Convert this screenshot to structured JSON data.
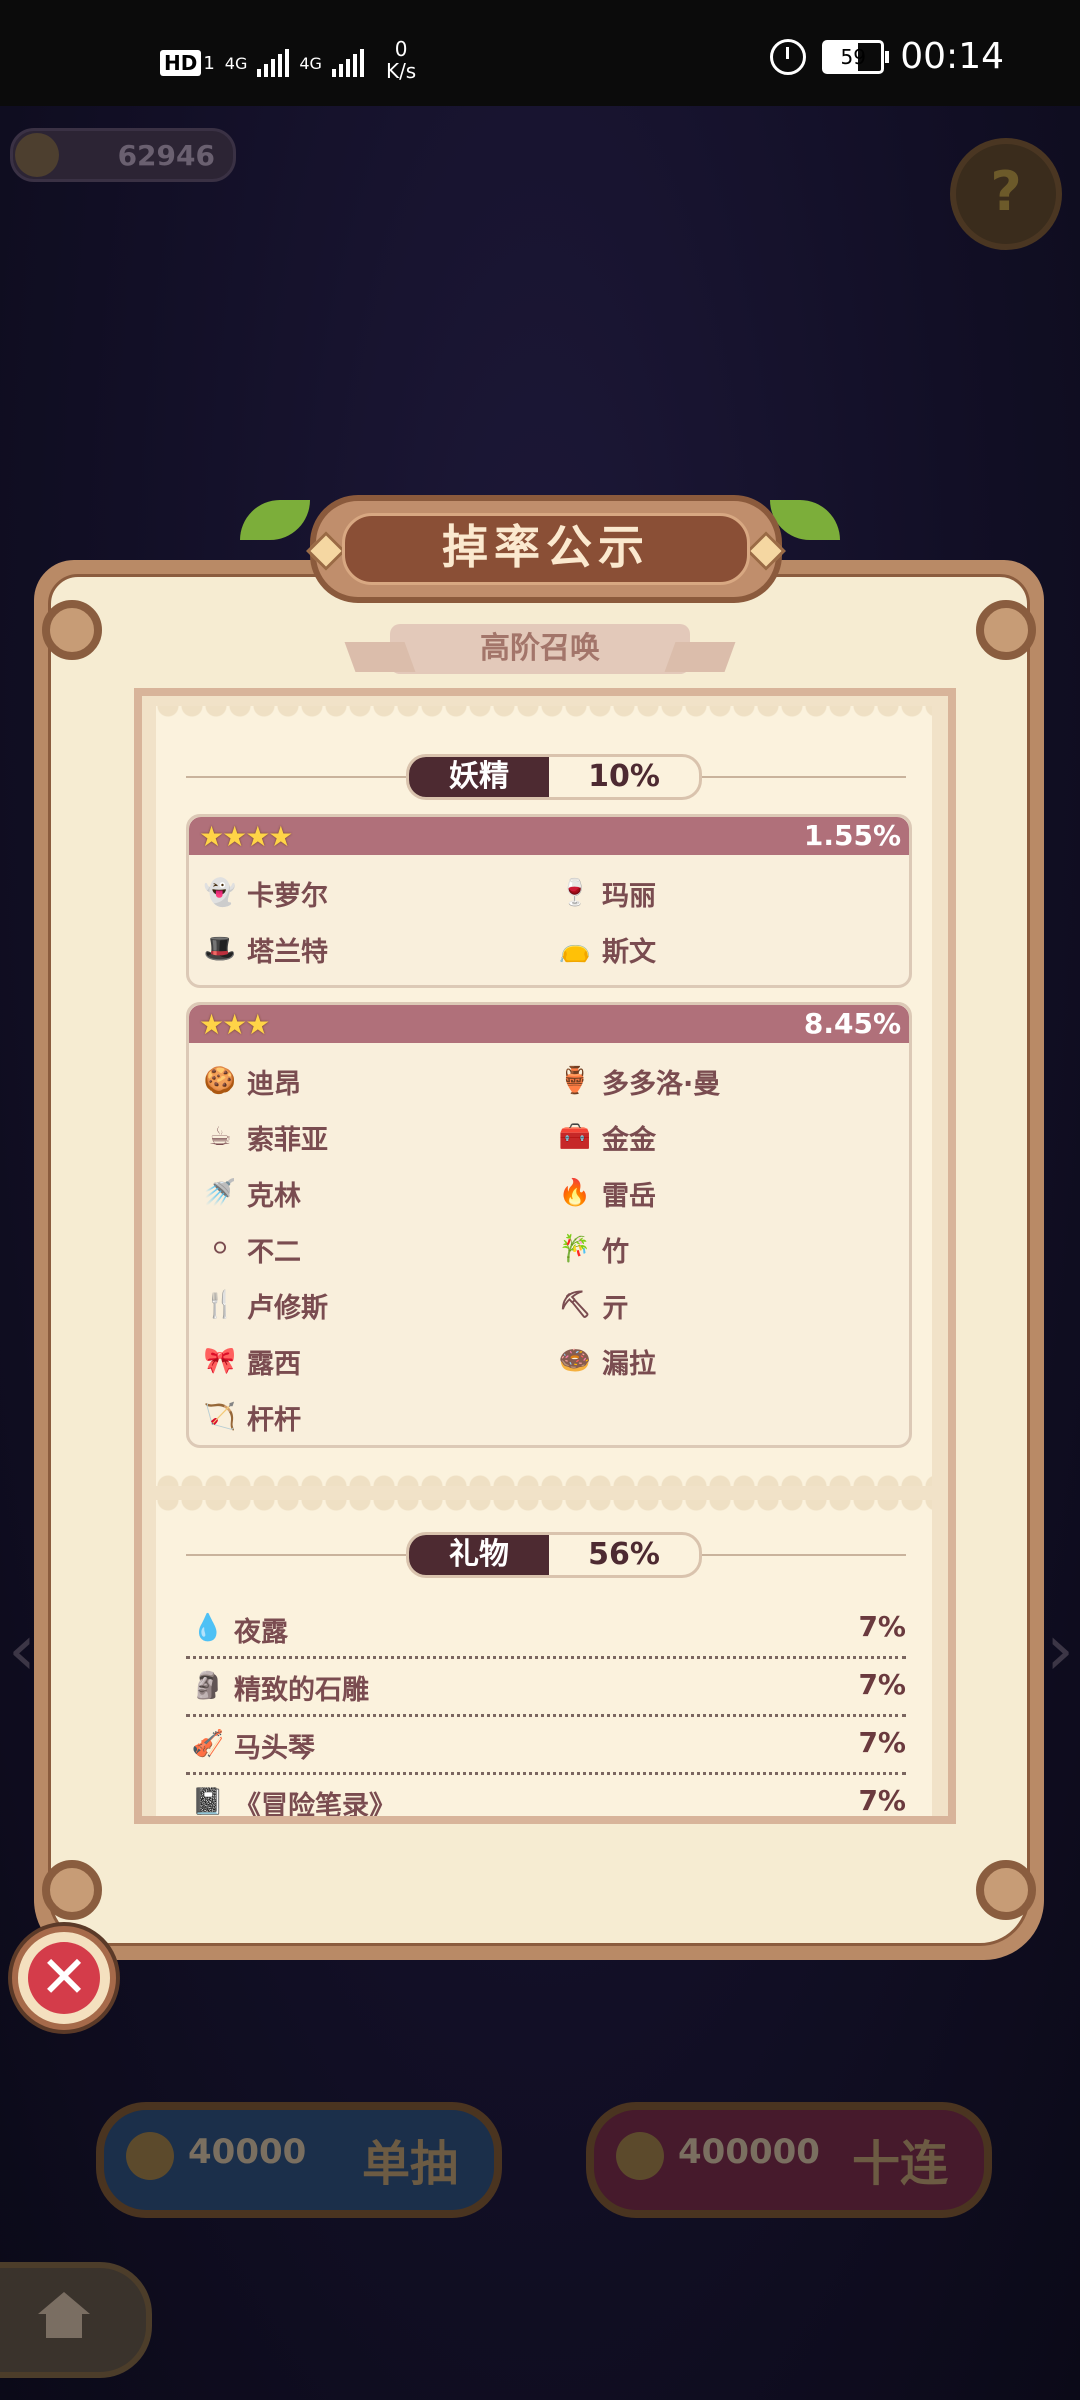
{
  "status_bar": {
    "hd": "HD",
    "sim": "1",
    "net1": "4G",
    "net2": "4G",
    "speed_value": "0",
    "speed_unit": "K/s",
    "battery": "59",
    "time": "00:14"
  },
  "hud": {
    "coins": "62946",
    "help_label": "?"
  },
  "panel": {
    "title": "掉率公示",
    "subtitle": "高阶召唤",
    "fairy_section": {
      "category": "妖精",
      "rate": "10%",
      "tiers": [
        {
          "stars": "★★★★",
          "rate": "1.55%",
          "items": [
            {
              "name": "卡萝尔",
              "icon": "ghost-icon",
              "glyph": "👻"
            },
            {
              "name": "玛丽",
              "icon": "potion-icon",
              "glyph": "🍷"
            },
            {
              "name": "塔兰特",
              "icon": "witch-hat-icon",
              "glyph": "🎩"
            },
            {
              "name": "斯文",
              "icon": "bag-icon",
              "glyph": "👝"
            }
          ]
        },
        {
          "stars": "★★★",
          "rate": "8.45%",
          "items": [
            {
              "name": "迪昂",
              "icon": "cookie-icon",
              "glyph": "🍪"
            },
            {
              "name": "多多洛·曼",
              "icon": "pot-icon",
              "glyph": "🏺"
            },
            {
              "name": "索菲亚",
              "icon": "teacup-icon",
              "glyph": "☕"
            },
            {
              "name": "金金",
              "icon": "chest-icon",
              "glyph": "🧰"
            },
            {
              "name": "克林",
              "icon": "watering-can-icon",
              "glyph": "🚿"
            },
            {
              "name": "雷岳",
              "icon": "torch-icon",
              "glyph": "🔥"
            },
            {
              "name": "不二",
              "icon": "snowball-icon",
              "glyph": "⚪"
            },
            {
              "name": "竹",
              "icon": "bamboo-icon",
              "glyph": "🎋"
            },
            {
              "name": "卢修斯",
              "icon": "fork-icon",
              "glyph": "🍴"
            },
            {
              "name": "亓",
              "icon": "shovel-icon",
              "glyph": "⛏"
            },
            {
              "name": "露西",
              "icon": "bow-icon",
              "glyph": "🎀"
            },
            {
              "name": "漏拉",
              "icon": "donut-icon",
              "glyph": "🍩"
            },
            {
              "name": "杆杆",
              "icon": "slingshot-icon",
              "glyph": "🏹"
            }
          ]
        }
      ]
    },
    "gift_section": {
      "category": "礼物",
      "rate": "56%",
      "items": [
        {
          "name": "夜露",
          "rate": "7%",
          "icon": "dew-icon",
          "glyph": "💧"
        },
        {
          "name": "精致的石雕",
          "rate": "7%",
          "icon": "statue-icon",
          "glyph": "🗿"
        },
        {
          "name": "马头琴",
          "rate": "7%",
          "icon": "fiddle-icon",
          "glyph": "🎻"
        },
        {
          "name": "《冒险笔录》",
          "rate": "7%",
          "icon": "book-icon",
          "glyph": "📓"
        }
      ]
    },
    "close_label": "✕"
  },
  "bottom": {
    "single": {
      "cost": "40000",
      "label": "单抽"
    },
    "ten": {
      "cost": "400000",
      "label": "十连"
    }
  }
}
